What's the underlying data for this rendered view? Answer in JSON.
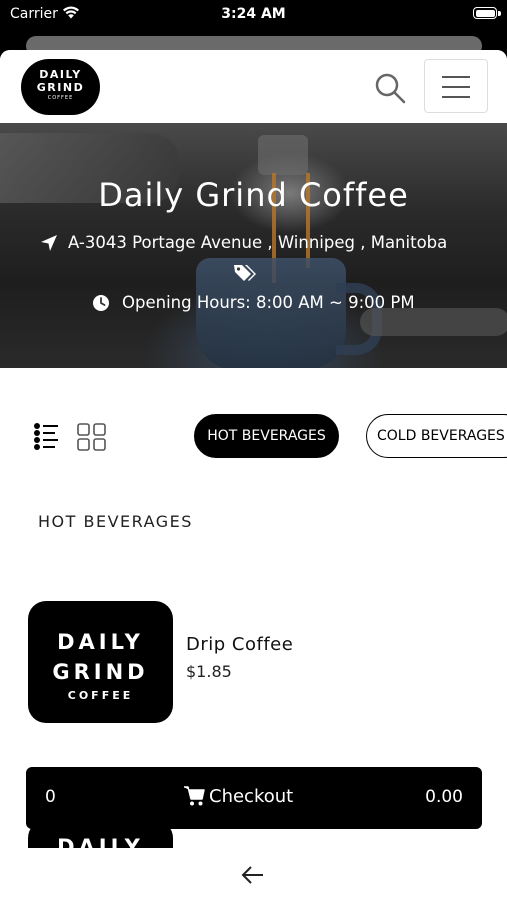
{
  "status_bar": {
    "carrier": "Carrier",
    "time": "3:24 AM"
  },
  "header": {
    "logo": {
      "line1": "DAILY",
      "line2": "GRIND",
      "line3": "COFFEE"
    },
    "search_icon": "search-icon",
    "menu_icon": "hamburger-menu-icon"
  },
  "hero": {
    "title": "Daily Grind Coffee",
    "address": "A-3043 Portage Avenue , Winnipeg , Manitoba",
    "hours": "Opening Hours: 8:00 AM ~ 9:00 PM",
    "icons": [
      "location-arrow-icon",
      "tags-icon",
      "clock-icon"
    ]
  },
  "filters": {
    "view_icons": [
      "list-view-icon",
      "grid-view-icon"
    ],
    "categories": [
      {
        "label": "HOT BEVERAGES",
        "selected": true
      },
      {
        "label": "COLD BEVERAGES",
        "selected": false
      }
    ]
  },
  "menu": {
    "section_title": "HOT BEVERAGES",
    "items": [
      {
        "name": "Drip Coffee",
        "price": "$1.85",
        "image_text": {
          "line1": "DAILY",
          "line2": "GRIND",
          "line3": "COFFEE"
        }
      },
      {
        "name": "",
        "price": "",
        "image_text": {
          "line1": "DAILY"
        }
      }
    ]
  },
  "checkout": {
    "count": "0",
    "label": "Checkout",
    "total": "0.00"
  },
  "colors": {
    "accent": "#000000",
    "background": "#ffffff",
    "text": "#111111"
  }
}
